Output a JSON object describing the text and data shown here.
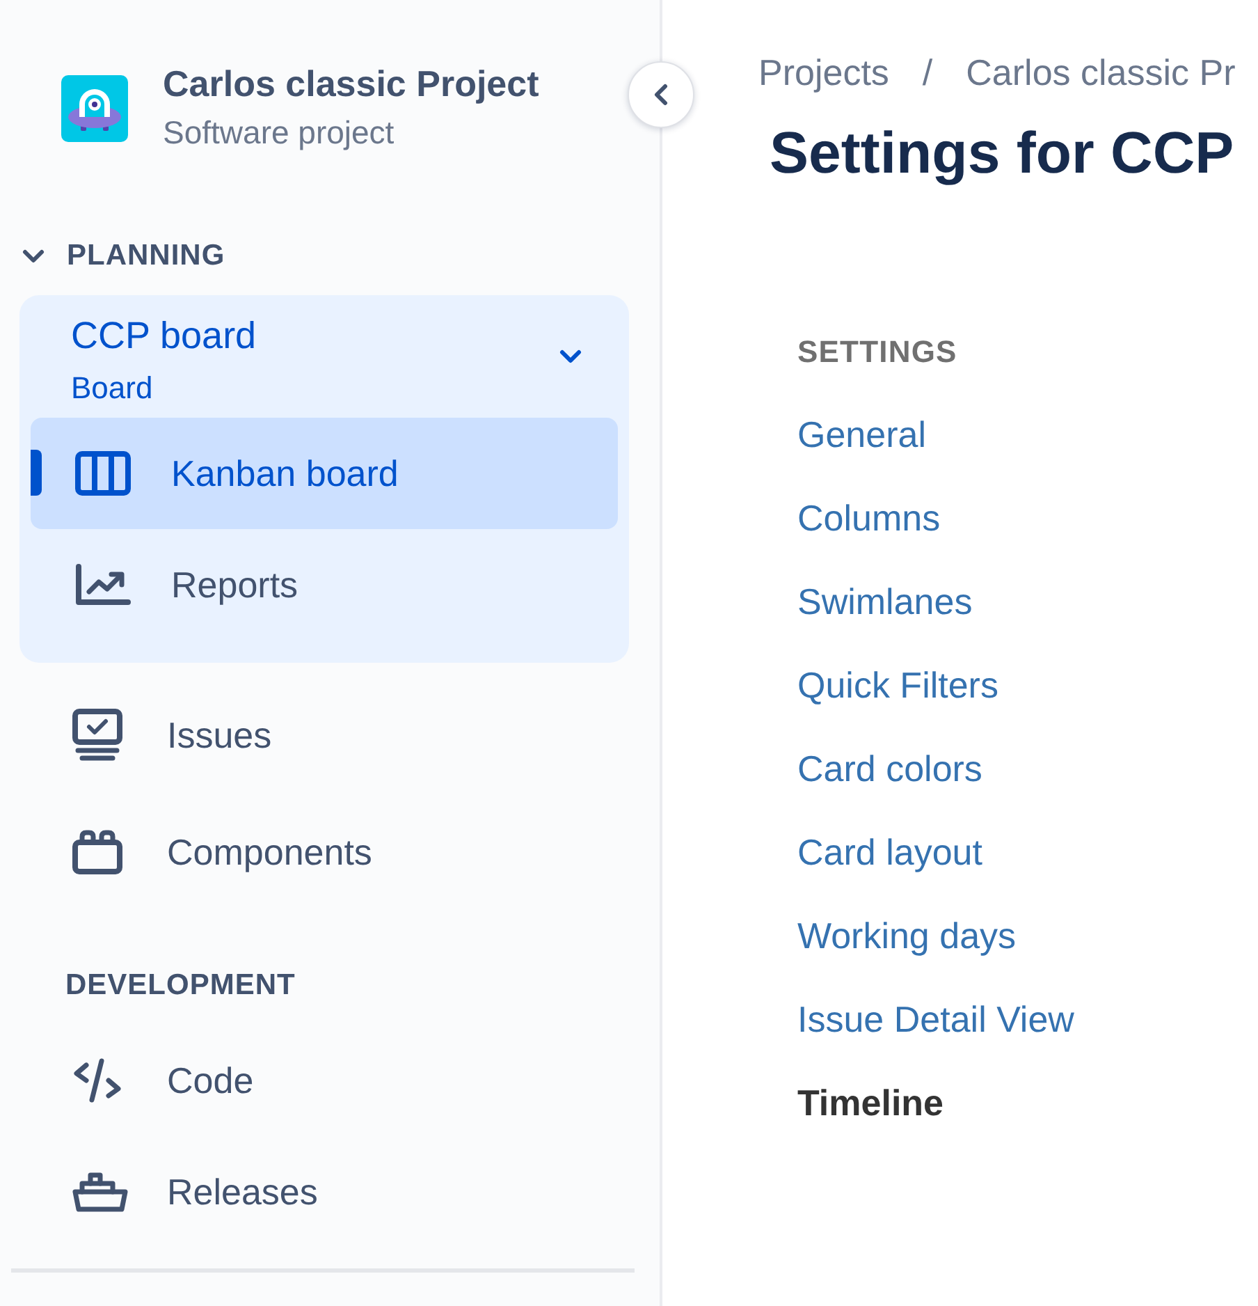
{
  "project": {
    "name": "Carlos classic Project",
    "type": "Software project"
  },
  "sidebar": {
    "sections": [
      {
        "heading": "PLANNING",
        "expanded": true,
        "items": [
          {
            "kind": "board",
            "label": "CCP board",
            "sublabel": "Board",
            "expanded": true,
            "children": [
              {
                "label": "Kanban board",
                "selected": true
              },
              {
                "label": "Reports",
                "selected": false
              }
            ]
          },
          {
            "kind": "link",
            "label": "Issues",
            "selected": false
          },
          {
            "kind": "link",
            "label": "Components",
            "selected": false
          }
        ]
      },
      {
        "heading": "DEVELOPMENT",
        "items": [
          {
            "kind": "link",
            "label": "Code",
            "selected": false
          },
          {
            "kind": "link",
            "label": "Releases",
            "selected": false
          }
        ]
      }
    ]
  },
  "breadcrumb": {
    "separator": "/",
    "items": [
      "Projects",
      "Carlos classic Pr"
    ]
  },
  "page_title": "Settings for CCP",
  "settings_nav": {
    "heading": "SETTINGS",
    "items": [
      {
        "label": "General",
        "selected": false
      },
      {
        "label": "Columns",
        "selected": false
      },
      {
        "label": "Swimlanes",
        "selected": false
      },
      {
        "label": "Quick Filters",
        "selected": false
      },
      {
        "label": "Card colors",
        "selected": false
      },
      {
        "label": "Card layout",
        "selected": false
      },
      {
        "label": "Working days",
        "selected": false
      },
      {
        "label": "Issue Detail View",
        "selected": false
      },
      {
        "label": "Timeline",
        "selected": true
      }
    ]
  }
}
